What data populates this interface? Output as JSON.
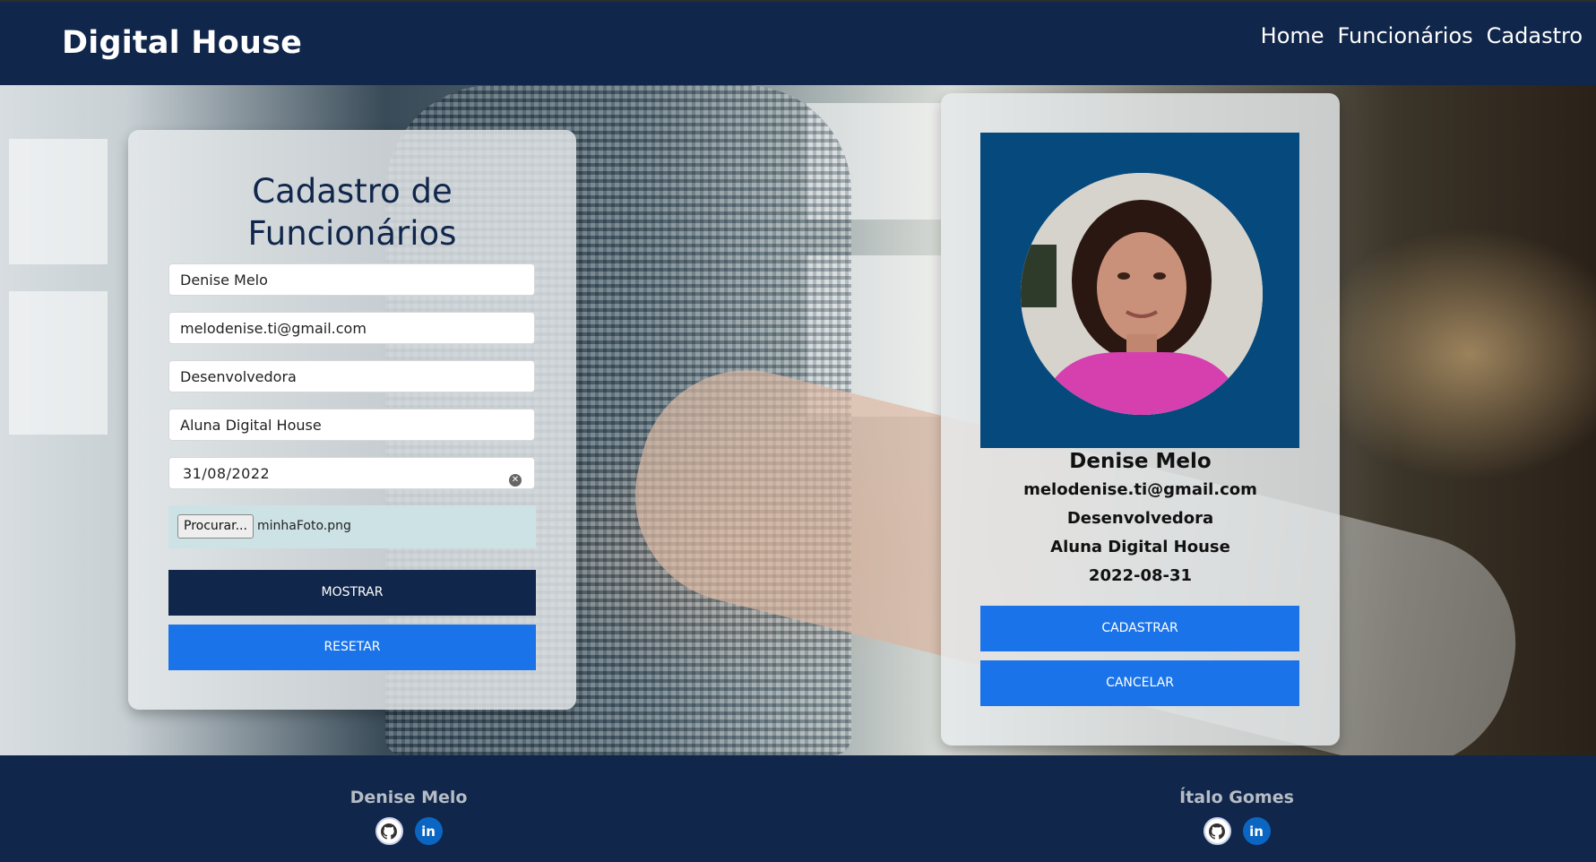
{
  "header": {
    "brand": "Digital House",
    "nav": [
      "Home",
      "Funcionários",
      "Cadastro"
    ]
  },
  "form": {
    "title_line1": "Cadastro de",
    "title_line2": "Funcionários",
    "name": "Denise Melo",
    "email": "melodenise.ti@gmail.com",
    "role": "Desenvolvedora",
    "company": "Aluna Digital House",
    "date": "31/08/2022",
    "file_button": "Procurar...",
    "file_name": "minhaFoto.png",
    "show_button": "MOSTRAR",
    "reset_button": "RESETAR"
  },
  "profile": {
    "name": "Denise Melo",
    "email": "melodenise.ti@gmail.com",
    "role": "Desenvolvedora",
    "company": "Aluna Digital House",
    "date": "2022-08-31",
    "register_button": "CADASTRAR",
    "cancel_button": "CANCELAR"
  },
  "footer": {
    "credits": [
      {
        "name": "Denise Melo",
        "icons": [
          "github-icon",
          "linkedin-icon"
        ]
      },
      {
        "name": "Ítalo Gomes",
        "icons": [
          "github-icon",
          "linkedin-icon"
        ]
      }
    ],
    "linkedin_glyph": "in"
  },
  "colors": {
    "navy": "#10264b",
    "blue_button": "#1a73e8",
    "photo_bg": "#06497d",
    "file_row": "#cde2e5"
  }
}
